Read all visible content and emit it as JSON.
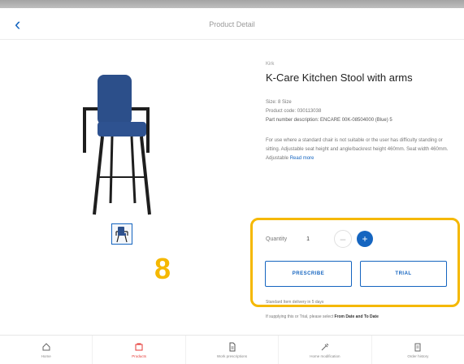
{
  "header": {
    "title": "Product Detail"
  },
  "product": {
    "brand": "Kirk",
    "name": "K-Care Kitchen Stool with arms",
    "meta_lines": [
      "Size: 8 Size",
      "Product code: 030113038",
      "Part number description: ENCARE 00K-08504000 (Blue) 5"
    ],
    "description": "For use where a standard chair is not suitable or the user has difficulty standing or sitting. Adjustable seat height and angle/backrest height 460mm. Seat width 460mm. Adjustable",
    "read_more": "Read more"
  },
  "quantity": {
    "label": "Quantity",
    "value": "1",
    "minus": "–",
    "plus": "+"
  },
  "actions": {
    "prescribe": "PRESCRIBE",
    "trial": "TRIAL"
  },
  "delivery_note": "Standard Item delivery in 5 days",
  "supplier_note": "If supplying this or Trial, please select ",
  "supplier_link": "From Date and To Date",
  "step_badge": "8",
  "tabs": [
    {
      "label": "Home",
      "icon": "home-icon"
    },
    {
      "label": "Products",
      "icon": "products-icon"
    },
    {
      "label": "Work prescriptions",
      "icon": "document-icon"
    },
    {
      "label": "Home modification",
      "icon": "tools-icon"
    },
    {
      "label": "Order history",
      "icon": "clipboard-icon"
    }
  ],
  "colors": {
    "accent": "#1565c0",
    "highlight": "#f5b800",
    "active_tab": "#e53935"
  }
}
